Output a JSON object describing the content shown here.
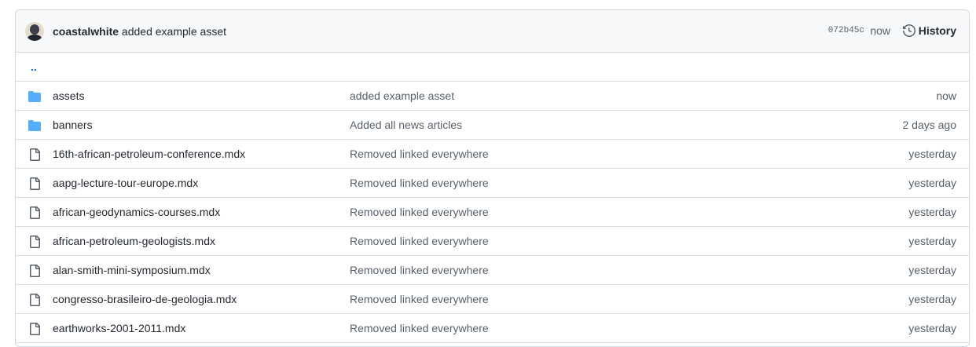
{
  "latest_commit": {
    "author": "coastalwhite",
    "message": "added example asset",
    "sha": "072b45c",
    "when": "now",
    "history_label": "History"
  },
  "parent_link": "..",
  "entries": [
    {
      "type": "folder",
      "name": "assets",
      "message": "added example asset",
      "age": "now"
    },
    {
      "type": "folder",
      "name": "banners",
      "message": "Added all news articles",
      "age": "2 days ago"
    },
    {
      "type": "file",
      "name": "16th-african-petroleum-conference.mdx",
      "message": "Removed linked everywhere",
      "age": "yesterday"
    },
    {
      "type": "file",
      "name": "aapg-lecture-tour-europe.mdx",
      "message": "Removed linked everywhere",
      "age": "yesterday"
    },
    {
      "type": "file",
      "name": "african-geodynamics-courses.mdx",
      "message": "Removed linked everywhere",
      "age": "yesterday"
    },
    {
      "type": "file",
      "name": "african-petroleum-geologists.mdx",
      "message": "Removed linked everywhere",
      "age": "yesterday"
    },
    {
      "type": "file",
      "name": "alan-smith-mini-symposium.mdx",
      "message": "Removed linked everywhere",
      "age": "yesterday"
    },
    {
      "type": "file",
      "name": "congresso-brasileiro-de-geologia.mdx",
      "message": "Removed linked everywhere",
      "age": "yesterday"
    },
    {
      "type": "file",
      "name": "earthworks-2001-2011.mdx",
      "message": "Removed linked everywhere",
      "age": "yesterday"
    }
  ],
  "colors": {
    "folder": "#54aeff",
    "file_icon": "#57606a",
    "link": "#0969da"
  }
}
